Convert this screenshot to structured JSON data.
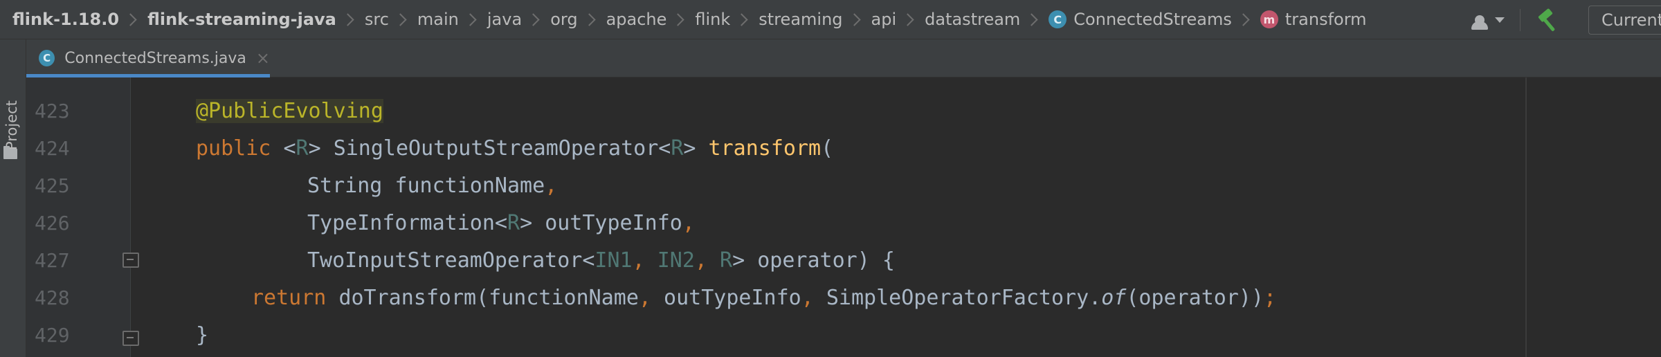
{
  "breadcrumb": {
    "project": "flink-1.18.0",
    "module": "flink-streaming-java",
    "path": [
      "src",
      "main",
      "java",
      "org",
      "apache",
      "flink",
      "streaming",
      "api",
      "datastream"
    ],
    "class": {
      "badge": "C",
      "label": "ConnectedStreams"
    },
    "method": {
      "badge": "m",
      "label": "transform"
    }
  },
  "toolbar": {
    "run_config_label": "Current File"
  },
  "sidebar": {
    "project_tab_label": "Project"
  },
  "tabs": [
    {
      "badge": "C",
      "label": "ConnectedStreams.java",
      "close": "×",
      "active": true
    }
  ],
  "editor": {
    "lines": [
      {
        "number": "423"
      },
      {
        "number": "424"
      },
      {
        "number": "425"
      },
      {
        "number": "426"
      },
      {
        "number": "427"
      },
      {
        "number": "428"
      },
      {
        "number": "429"
      }
    ],
    "code": {
      "l423": {
        "annotation": "@PublicEvolving"
      },
      "l424": {
        "kw_public": "public",
        "lt1": "<",
        "r1": "R",
        "gt1": ">",
        "ret_type": "SingleOutputStreamOperator",
        "lt2": "<",
        "r2": "R",
        "gt2": ">",
        "method": "transform",
        "paren": "("
      },
      "l425": {
        "type": "String",
        "name": "functionName",
        "comma": ","
      },
      "l426": {
        "type": "TypeInformation",
        "lt": "<",
        "r": "R",
        "gt": ">",
        "name": "outTypeInfo",
        "comma": ","
      },
      "l427": {
        "type": "TwoInputStreamOperator",
        "lt": "<",
        "in1": "IN1",
        "c1": ",",
        "in2": "IN2",
        "c2": ",",
        "r": "R",
        "rest": "> operator) {"
      },
      "l428": {
        "kw_return": "return",
        "call": "doTransform(functionName",
        "c1": ",",
        "arg2": "outTypeInfo",
        "c2": ",",
        "factory": "SimpleOperatorFactory.",
        "of": "of",
        "tail": "(operator))",
        "semi": ";"
      },
      "l429": {
        "brace": "}"
      }
    }
  },
  "colors": {
    "keyword": "#cc7832",
    "annotation": "#bbb529",
    "type_param": "#507874",
    "method_decl": "#ffc66d",
    "default_text": "#a9b7c6",
    "tab_underline": "#4a88c7"
  }
}
